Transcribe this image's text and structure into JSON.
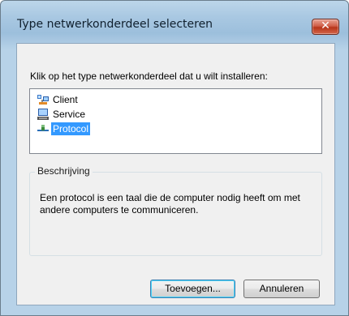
{
  "window": {
    "title": "Type netwerkonderdeel selecteren",
    "close_label": "✕"
  },
  "dialog": {
    "prompt": "Klik op het type netwerkonderdeel dat u wilt installeren:",
    "items": [
      {
        "label": "Client",
        "icon": "client-icon",
        "selected": false
      },
      {
        "label": "Service",
        "icon": "service-icon",
        "selected": false
      },
      {
        "label": "Protocol",
        "icon": "protocol-icon",
        "selected": true
      }
    ],
    "group_title": "Beschrijving",
    "description": "Een protocol is een taal die de computer nodig heeft om met andere computers te communiceren."
  },
  "buttons": {
    "add_label": "Toevoegen...",
    "cancel_label": "Annuleren"
  },
  "colors": {
    "selection": "#3399ff",
    "close_button": "#c8452b",
    "frame": "#a9c8e2"
  }
}
